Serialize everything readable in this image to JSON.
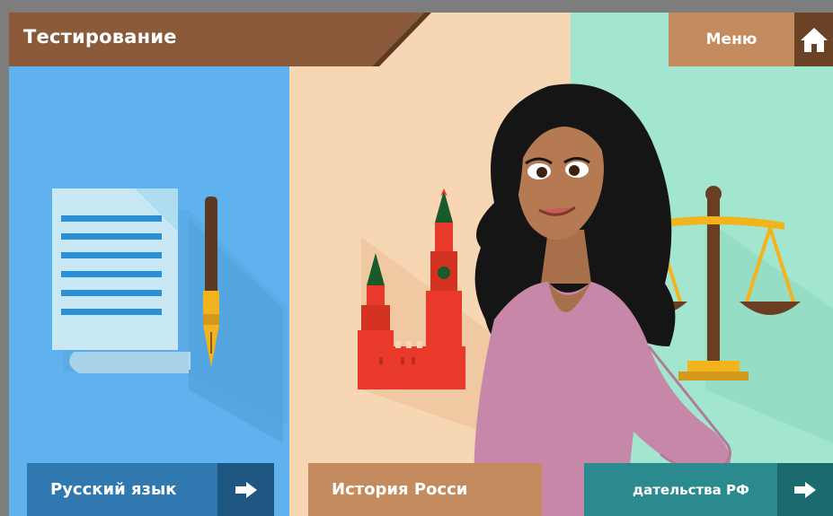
{
  "app": {
    "title": "Тестирование",
    "menu_label": "Меню"
  },
  "subjects": [
    {
      "label": "Русский язык",
      "icon": "document-pen-icon",
      "color": "#5fb2ee"
    },
    {
      "label": "История Росси",
      "icon": "kremlin-icon",
      "color": "#f7d7b3"
    },
    {
      "label": "дательства РФ",
      "icon": "scales-icon",
      "color": "#a3e6cf"
    }
  ],
  "colors": {
    "titlebar": "#8a5a3a",
    "menu_button": "#c48b5e",
    "home_button": "#6a4327"
  }
}
